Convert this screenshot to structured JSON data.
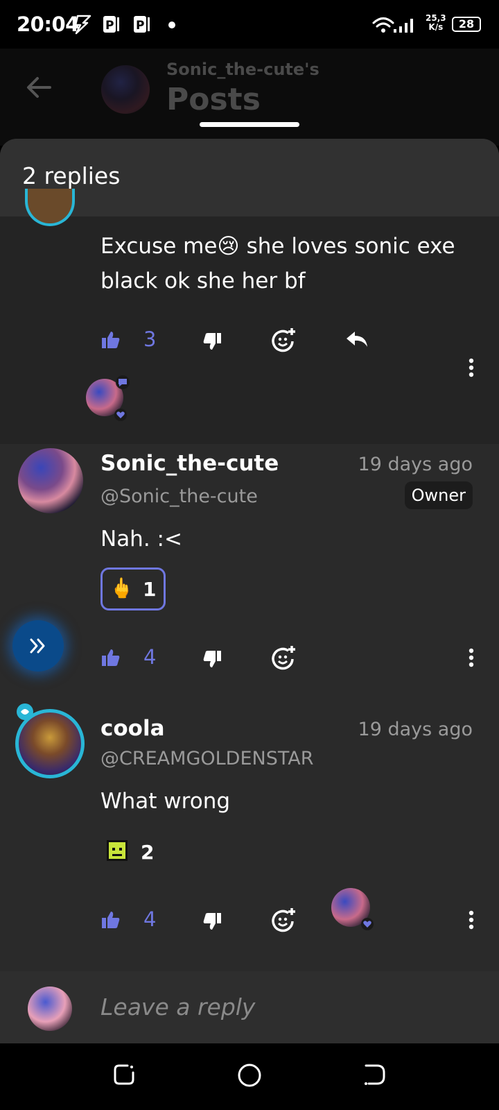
{
  "status_bar": {
    "time": "20:04",
    "speed_value": "25,3",
    "speed_unit": "K/s",
    "battery": "28"
  },
  "background_header": {
    "owner": "Sonic_the-cute's",
    "title": "Posts"
  },
  "sheet": {
    "title": "2 replies"
  },
  "parent_comment": {
    "text_line1": "Excuse me😢 she loves sonic exe",
    "text_line2": "black ok she her bf",
    "likes": "3"
  },
  "replies": [
    {
      "name": "Sonic_the-cute",
      "handle": "@Sonic_the-cute",
      "time": "19 days ago",
      "badge": "Owner",
      "text": "Nah.   :<",
      "reaction_emoji": "🖕",
      "reaction_count": "1",
      "likes": "4"
    },
    {
      "name": "coola",
      "handle": "@CREAMGOLDENSTAR",
      "time": "19 days ago",
      "text": "What wrong",
      "reaction_count": "2",
      "likes": "4"
    }
  ],
  "reply_bar": {
    "placeholder": "Leave a reply"
  },
  "colors": {
    "accent": "#6f77e0",
    "sheet_bg": "#2a2a2a",
    "ring": "#29b6d6"
  },
  "icons": [
    "lightning-icon",
    "parking-icon",
    "wifi-icon",
    "signal-icon",
    "battery-icon",
    "back-arrow-icon",
    "thumbs-up-icon",
    "thumbs-down-icon",
    "add-reaction-icon",
    "reply-icon",
    "more-vert-icon",
    "fast-forward-icon",
    "recent-apps-icon",
    "home-icon",
    "back-icon"
  ]
}
